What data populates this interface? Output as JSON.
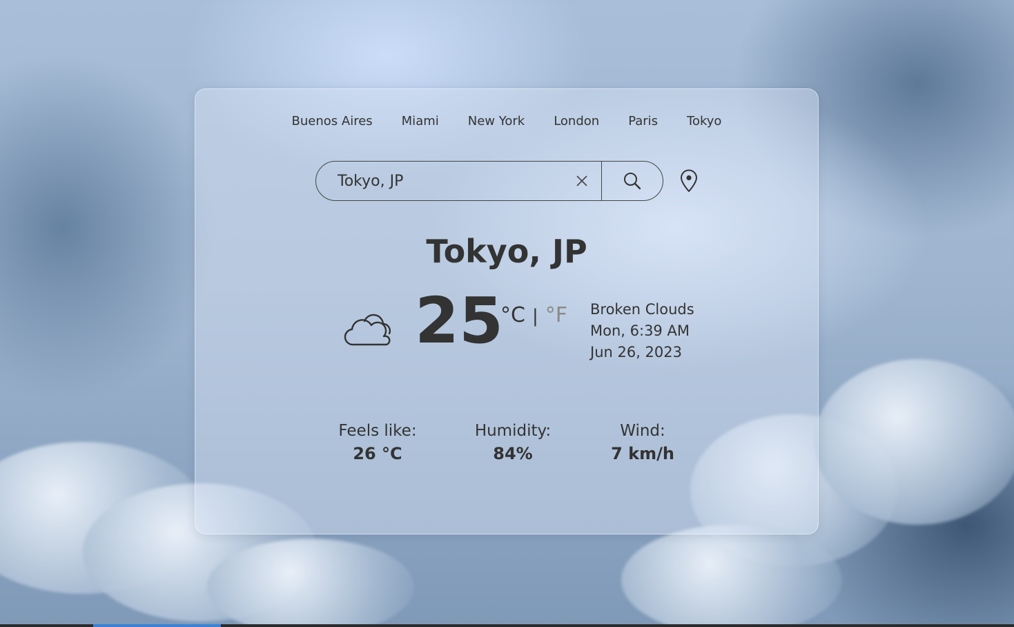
{
  "nav": {
    "cities": [
      "Buenos Aires",
      "Miami",
      "New York",
      "London",
      "Paris",
      "Tokyo"
    ]
  },
  "search": {
    "value": "Tokyo, JP"
  },
  "icons": {
    "clear": "close-icon",
    "search": "search-icon",
    "location": "map-pin-icon",
    "weather": "cloud-icon"
  },
  "weather": {
    "city": "Tokyo, JP",
    "temperature": "25",
    "unit_celsius": "°C",
    "unit_separator": "|",
    "unit_fahrenheit": "°F",
    "description": "Broken Clouds",
    "time": "Mon, 6:39 AM",
    "date": "Jun 26, 2023"
  },
  "stats": {
    "feels_like_label": "Feels like:",
    "feels_like_value": "26 °C",
    "humidity_label": "Humidity:",
    "humidity_value": "84%",
    "wind_label": "Wind:",
    "wind_value": "7 km/h"
  },
  "colors": {
    "text": "#333333",
    "inactive_unit": "#8a8a8a",
    "taskbar_accent": "#3b82d6"
  }
}
